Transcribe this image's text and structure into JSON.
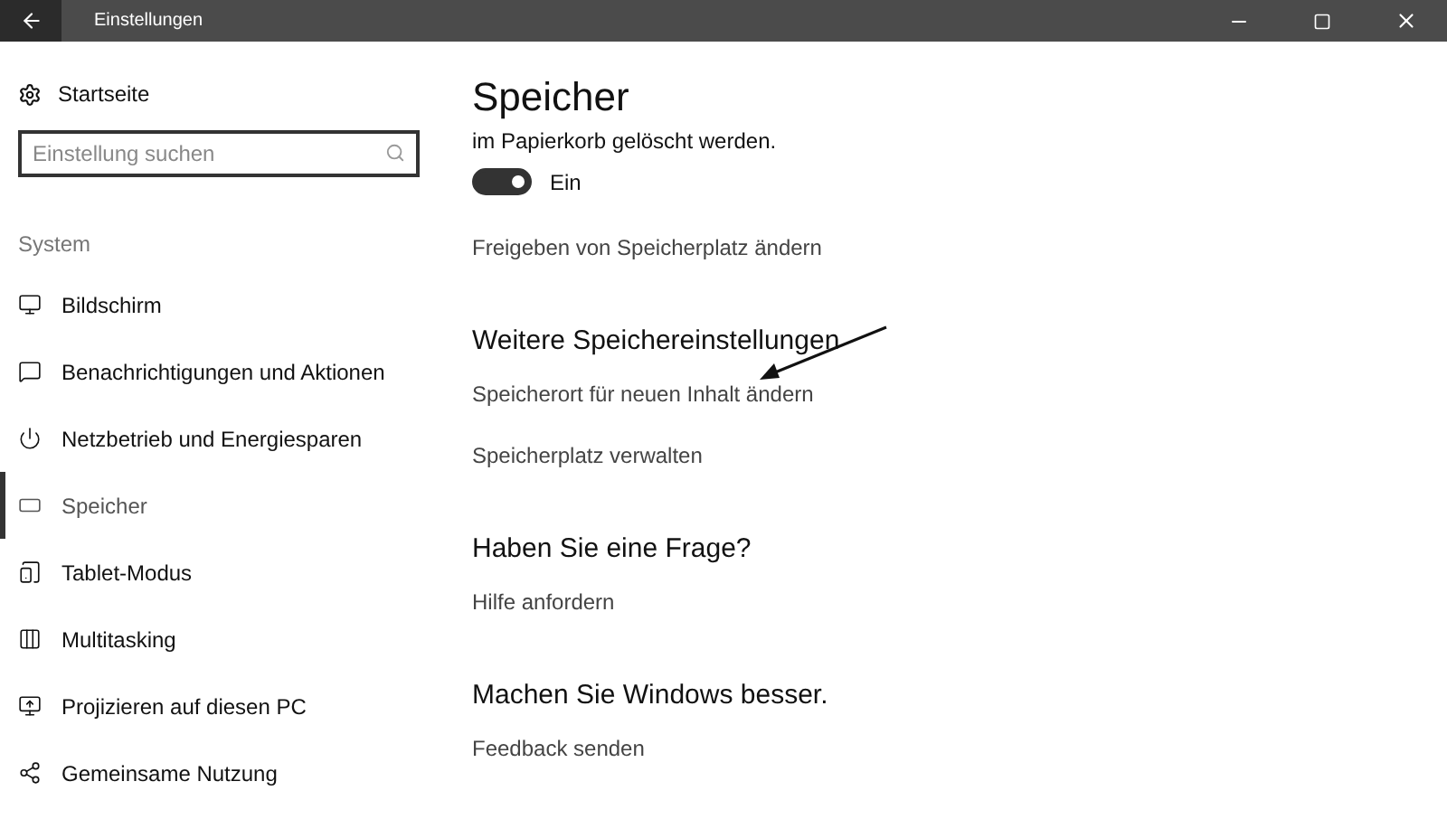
{
  "window": {
    "title": "Einstellungen"
  },
  "sidebar": {
    "home": "Startseite",
    "search": {
      "placeholder": "Einstellung suchen"
    },
    "section": "System",
    "items": [
      {
        "label": "Bildschirm",
        "kind": "display",
        "selected": false
      },
      {
        "label": "Benachrichtigungen und Aktionen",
        "kind": "notifications",
        "selected": false
      },
      {
        "label": "Netzbetrieb und Energiesparen",
        "kind": "power",
        "selected": false
      },
      {
        "label": "Speicher",
        "kind": "storage",
        "selected": true
      },
      {
        "label": "Tablet-Modus",
        "kind": "tablet",
        "selected": false
      },
      {
        "label": "Multitasking",
        "kind": "multitasking",
        "selected": false
      },
      {
        "label": "Projizieren auf diesen PC",
        "kind": "project",
        "selected": false
      },
      {
        "label": "Gemeinsame Nutzung",
        "kind": "share",
        "selected": false
      }
    ]
  },
  "main": {
    "title": "Speicher",
    "text": "im Papierkorb gelöscht werden.",
    "toggle": {
      "on": true,
      "label": "Ein"
    },
    "link": "Freigeben von Speicherplatz ändern",
    "sections": [
      {
        "heading": "Weitere Speichereinstellungen",
        "links": [
          "Speicherort für neuen Inhalt ändern",
          "Speicherplatz verwalten"
        ]
      },
      {
        "heading": "Haben Sie eine Frage?",
        "links": [
          "Hilfe anfordern"
        ]
      },
      {
        "heading": "Machen Sie Windows besser.",
        "links": [
          "Feedback senden"
        ]
      }
    ]
  }
}
